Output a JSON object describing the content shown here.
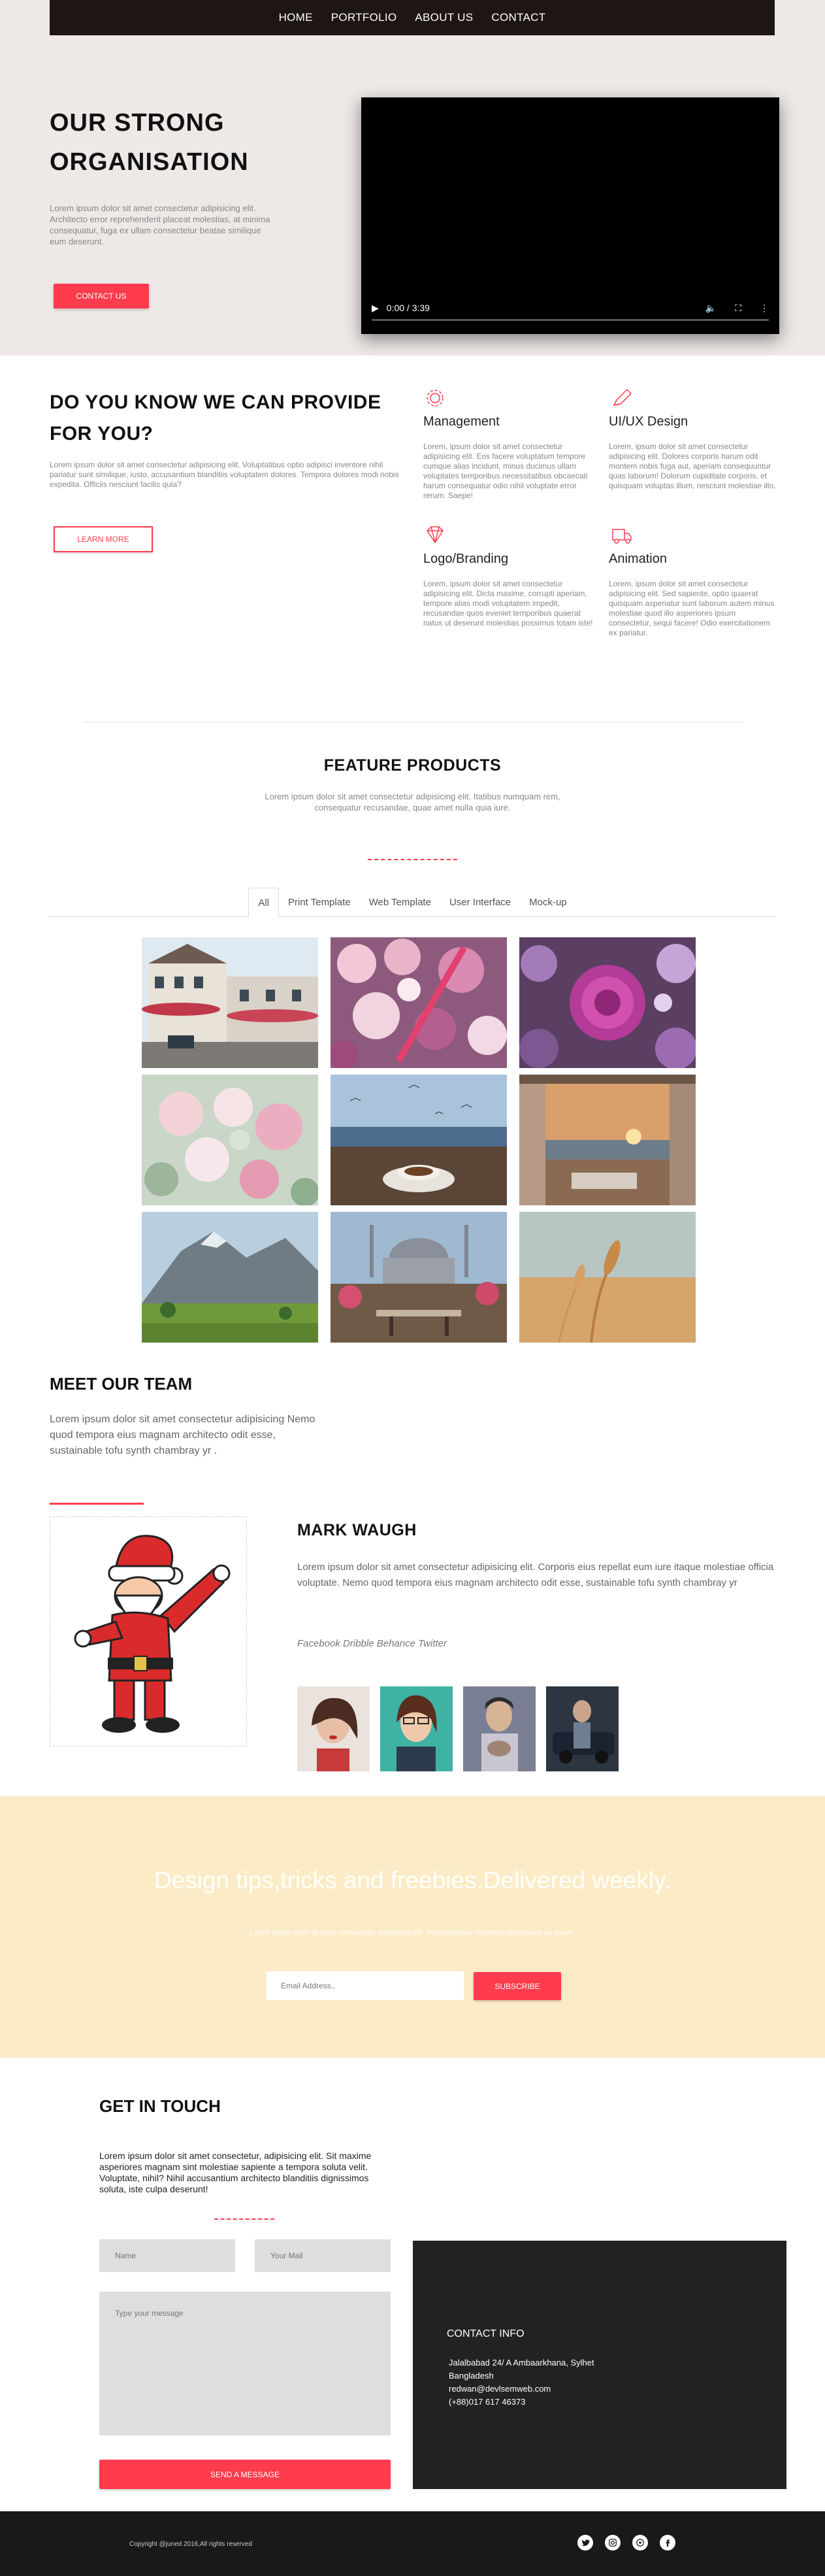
{
  "nav": {
    "items": [
      "HOME",
      "PORTFOLIO",
      "ABOUT US",
      "CONTACT"
    ]
  },
  "hero": {
    "title": "OUR STRONG ORGANISATION",
    "text": "Lorem ipsum dolor sit amet consectetur adipisicing elit. Architecto error reprehenderit placeat molestias, at minima consequatur, fuga ex ullam consectetur beatae similique eum deserunt.",
    "button": "CONTACT US",
    "video_time": "0:00 / 3:39"
  },
  "provide": {
    "title": "DO YOU KNOW WE CAN PROVIDE FOR YOU?",
    "text": "Lorem ipsum dolor sit amet consectetur adipisicing elit. Voluptatibus optio adipisci inventore nihil pariatur sunt similique, iusto, accusantium blanditiis voluptatem dolores. Tempora dolores modi nobis expedita. Officiis nesciunt facilis quia?",
    "button": "LEARN MORE",
    "services": [
      {
        "icon": "gear-icon",
        "title": "Management",
        "text": "Lorem, ipsum dolor sit amet consectetur adipisicing elit. Eos facere voluptatum tempore cumque alias incidunt, minus ducimus ullam voluptates temporibus necessitatibus obcaecati harum consequatur odio nihil voluptate error rerum. Saepe!"
      },
      {
        "icon": "pencil-icon",
        "title": "UI/UX Design",
        "text": "Lorem, ipsum dolor sit amet consectetur adipisicing elit. Dolores corporis harum odit montem nobis fuga aut, aperiam consequuntur quas laborum! Dolorum cupiditate corporis, et quisquam voluptas illum, nesciunt molestiae illo."
      },
      {
        "icon": "diamond-icon",
        "title": "Logo/Branding",
        "text": "Lorem, ipsum dolor sit amet consectetur adipisicing elit. Dicta maxime, corrupti aperiam, tempore alias modi voluptatem impedit, recusandae quos eveniet temporibus quaerat natus ut deserunt molestias possimus totam iste!"
      },
      {
        "icon": "truck-icon",
        "title": "Animation",
        "text": "Lorem, ipsum dolor sit amet consectetur adipisicing elit. Sed sapiente, optio quaerat quisquam asperiatur sunt laborum autem minus molestiae quod illo asperiores ipsum consectetur, sequi facere! Odio exercitationem ex pariatur."
      }
    ]
  },
  "feature": {
    "title": "FEATURE PRODUCTS",
    "subtitle": "Lorem ipsum dolor sit amet consectetur adipisicing elit. Itatibus numquam rem, consequatur recusandae, quae amet nulla quia iure.",
    "tabs": [
      "All",
      "Print Template",
      "Web Template",
      "User Interface",
      "Mock-up"
    ],
    "active_tab": "All"
  },
  "team": {
    "title": "MEET OUR TEAM",
    "text": "Lorem ipsum dolor sit amet consectetur adipisicing Nemo quod tempora eius magnam architecto odit esse, sustainable tofu synth chambray yr .",
    "member_name": "MARK WAUGH",
    "member_bio": "Lorem ipsum dolor sit amet consectetur adipisicing elit. Corporis eius repellat eum iure itaque molestiae officia voluptate. Nemo quod tempora eius magnam architecto odit esse, sustainable tofu synth chambray yr",
    "member_social": "Facebook Dribble Behance Twitter"
  },
  "newsletter": {
    "title": "Design tips,tricks and freebies.Delivered weekly.",
    "subtitle": "Lorem ipsum dolor sit amet consectetur adipisicing elit. Necessitatibus molestias laboriosam ex ipsum.",
    "email_placeholder": "Email Address..",
    "button": "SUBSCRIBE"
  },
  "contact": {
    "title": "GET IN TOUCH",
    "text": "Lorem ipsum dolor sit amet consectetur, adipisicing elit. Sit maxime asperiores magnam sint molestiae sapiente a tempora soluta velit. Voluptate, nihil? Nihil accusantium architecto blanditiis dignissimos soluta, iste culpa deserunt!",
    "name_placeholder": "Name",
    "mail_placeholder": "Your Mail",
    "message_placeholder": "Type your message",
    "button": "SEND A MESSAGE",
    "info_title": "CONTACT INFO",
    "info_lines": [
      "Jalalbabad 24/ A Ambaarkhana, Sylhet",
      "Bangladesh",
      "redwan@devlsemweb.com",
      "(+88)017 617 46373"
    ]
  },
  "footer": {
    "copyright": "Copyright @juned 2016,All rights reserved",
    "socials": [
      "twitter-icon",
      "instagram-icon",
      "dribbble-icon",
      "facebook-icon"
    ]
  },
  "colors": {
    "accent": "#ff3b4e",
    "hero_bg": "#eee8e7",
    "nav_bg": "#1e1615",
    "newsletter_bg": "#fbecc7",
    "dark": "#222222"
  }
}
